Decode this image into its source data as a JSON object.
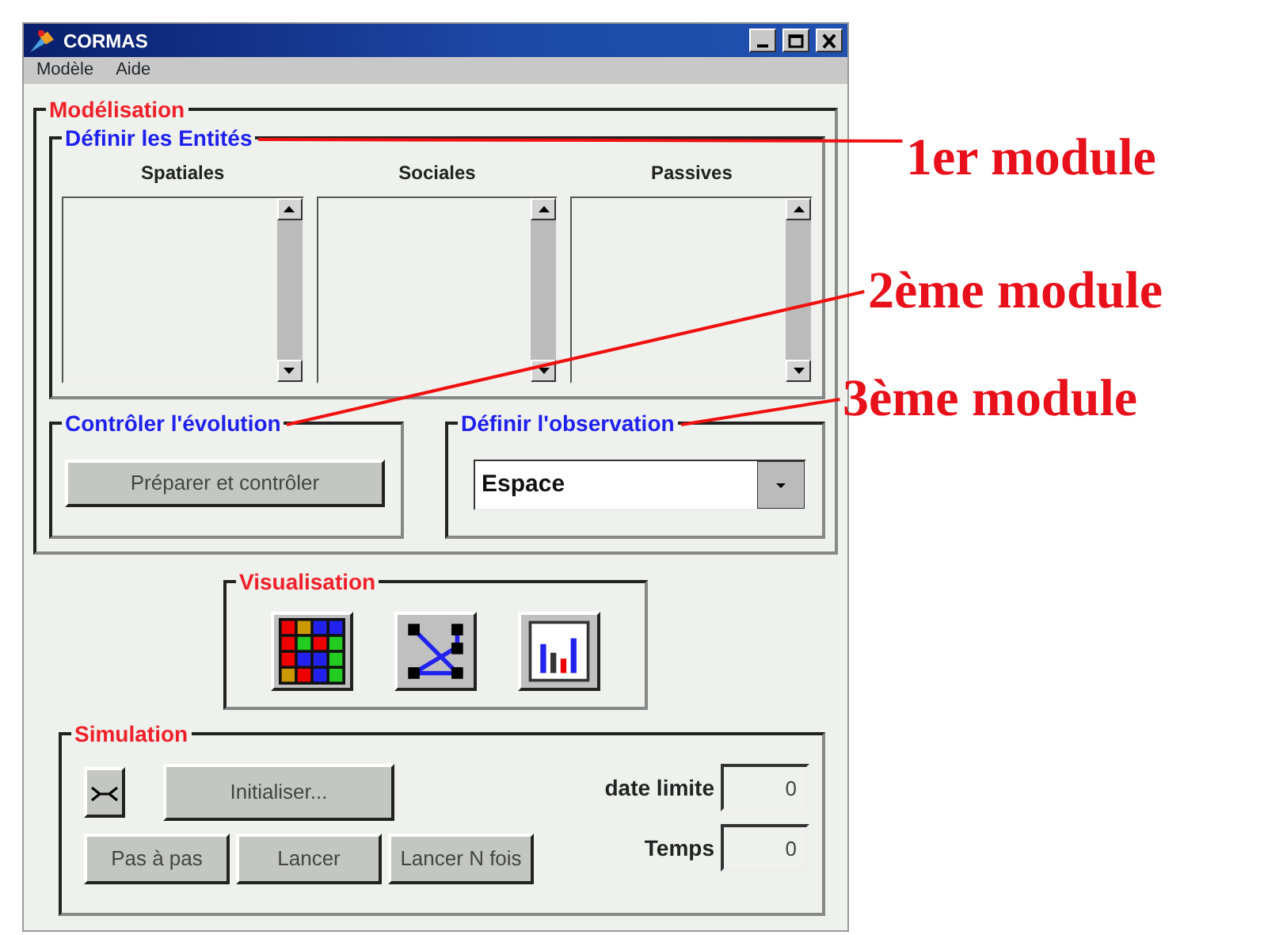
{
  "window": {
    "title": "CORMAS"
  },
  "menu": [
    "Modèle",
    "Aide"
  ],
  "modelisation": {
    "title": "Modélisation",
    "entities": {
      "title": "Définir les Entités",
      "lists": [
        {
          "label": "Spatiales"
        },
        {
          "label": "Sociales"
        },
        {
          "label": "Passives"
        }
      ]
    },
    "evolution": {
      "title": "Contrôler l'évolution",
      "button": "Préparer et contrôler"
    },
    "observation": {
      "title": "Définir l'observation",
      "value": "Espace"
    }
  },
  "visualisation": {
    "title": "Visualisation",
    "tools": [
      {
        "kind": "grid"
      },
      {
        "kind": "graph"
      },
      {
        "kind": "chart"
      }
    ]
  },
  "simulation": {
    "title": "Simulation",
    "initialise": "Initialiser...",
    "buttons": [
      "Pas à pas",
      "Lancer",
      "Lancer N fois"
    ],
    "fields": [
      {
        "label": "date limite",
        "value": "0"
      },
      {
        "label": "Temps",
        "value": "0"
      }
    ]
  },
  "annotations": [
    {
      "label": "1er module"
    },
    {
      "label": "2ème module"
    },
    {
      "label": "3ème module"
    }
  ]
}
